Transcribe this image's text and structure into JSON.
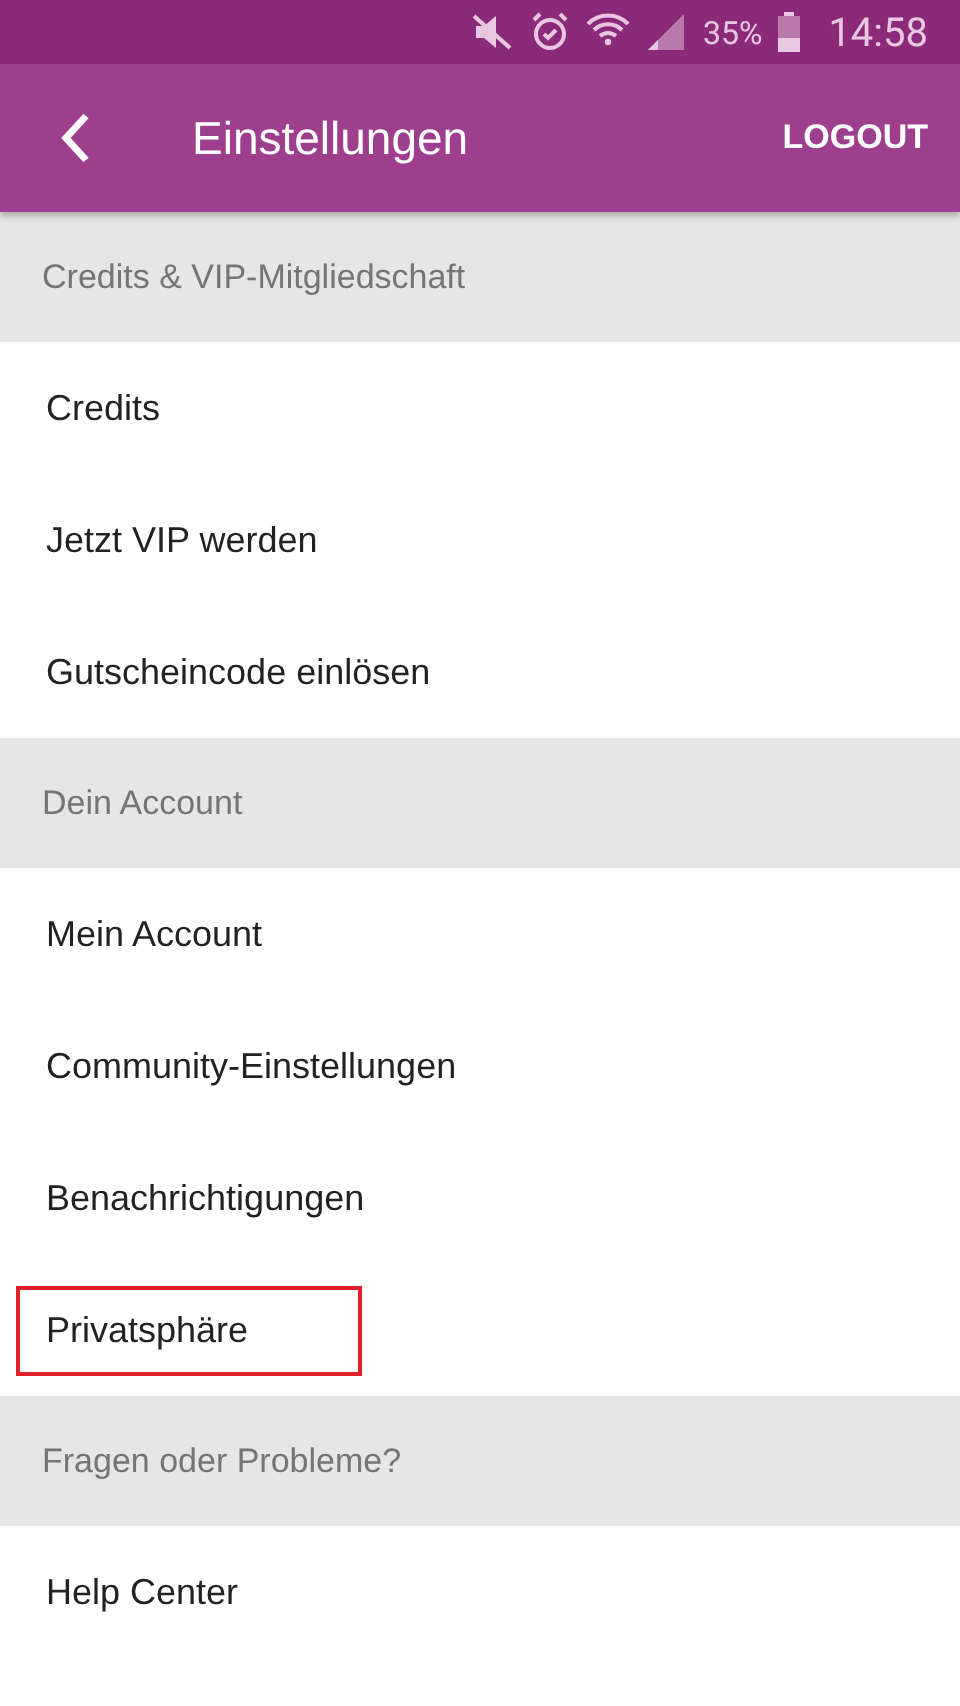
{
  "status_bar": {
    "battery_text": "35%",
    "time": "14:58"
  },
  "toolbar": {
    "title": "Einstellungen",
    "action": "LOGOUT"
  },
  "sections": [
    {
      "title": "Credits & VIP-Mitgliedschaft",
      "items": [
        {
          "label": "Credits",
          "highlighted": false
        },
        {
          "label": "Jetzt VIP werden",
          "highlighted": false
        },
        {
          "label": "Gutscheincode einlösen",
          "highlighted": false
        }
      ]
    },
    {
      "title": "Dein Account",
      "items": [
        {
          "label": "Mein Account",
          "highlighted": false
        },
        {
          "label": "Community-Einstellungen",
          "highlighted": false
        },
        {
          "label": "Benachrichtigungen",
          "highlighted": false
        },
        {
          "label": "Privatsphäre",
          "highlighted": true
        }
      ]
    },
    {
      "title": "Fragen oder Probleme?",
      "items": [
        {
          "label": "Help Center",
          "highlighted": false
        }
      ]
    }
  ]
}
